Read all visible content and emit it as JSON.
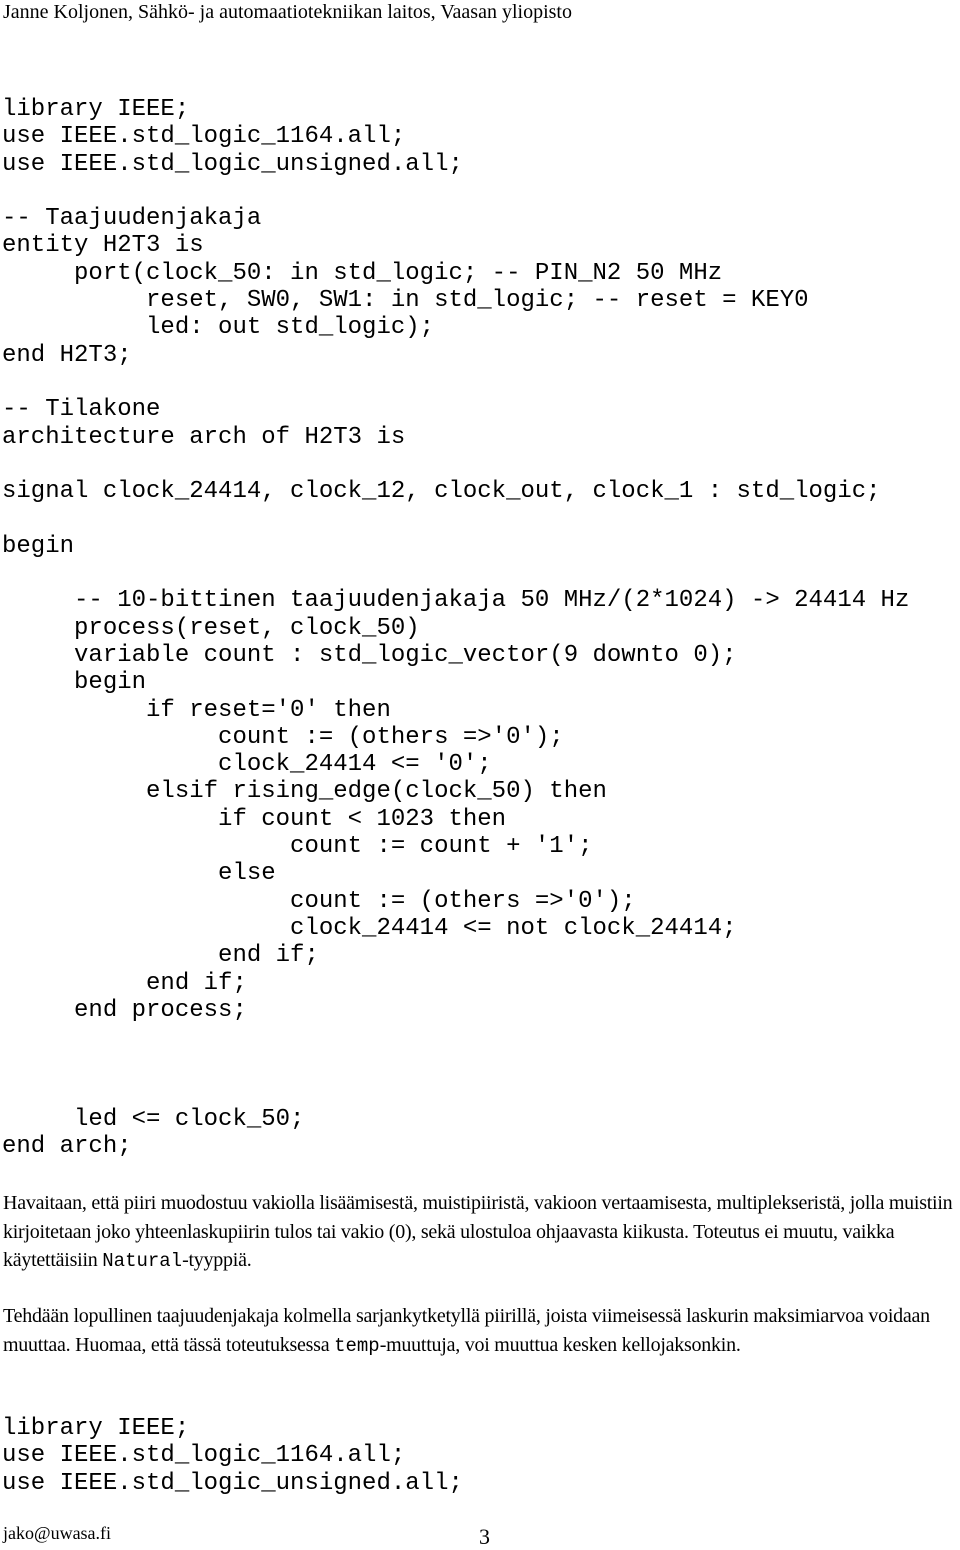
{
  "header": "Janne Koljonen, Sähkö- ja automaatiotekniikan laitos, Vaasan yliopisto",
  "code_block_1": [
    "library IEEE;",
    "use IEEE.std_logic_1164.all;",
    "use IEEE.std_logic_unsigned.all;",
    "",
    "-- Taajuudenjakaja",
    "entity H2T3 is",
    "     port(clock_50: in std_logic; -- PIN_N2 50 MHz",
    "          reset, SW0, SW1: in std_logic; -- reset = KEY0",
    "          led: out std_logic);",
    "end H2T3;",
    "",
    "-- Tilakone",
    "architecture arch of H2T3 is",
    "",
    "signal clock_24414, clock_12, clock_out, clock_1 : std_logic;",
    "",
    "begin",
    "",
    "     -- 10-bittinen taajuudenjakaja 50 MHz/(2*1024) -> 24414 Hz",
    "     process(reset, clock_50)",
    "     variable count : std_logic_vector(9 downto 0);",
    "     begin",
    "          if reset='0' then",
    "               count := (others =>'0');",
    "               clock_24414 <= '0';",
    "          elsif rising_edge(clock_50) then",
    "               if count < 1023 then",
    "                    count := count + '1';",
    "               else",
    "                    count := (others =>'0');",
    "                    clock_24414 <= not clock_24414;",
    "               end if;",
    "          end if;",
    "     end process;",
    "",
    "",
    "",
    "     led <= clock_50;",
    "end arch;"
  ],
  "paragraph_1": {
    "text_before": "Havaitaan, että piiri muodostuu vakiolla lisäämisestä, muistipiiristä, vakioon vertaamisesta, multiplekseristä, jolla muistiin kirjoitetaan joko yhteenlaskupiirin tulos tai vakio (0), sekä ulostuloa ohjaavasta kiikusta. Toteutus ei muutu, vaikka käytettäisiin ",
    "code": "Natural",
    "text_after": "-tyyppiä."
  },
  "paragraph_2": {
    "text_before": "Tehdään lopullinen taajuudenjakaja kolmella sarjankytketyllä piirillä, joista viimeisessä laskurin maksimiarvoa voidaan muuttaa. Huomaa, että tässä toteutuksessa ",
    "code": "temp",
    "text_after": "-muuttuja, voi muuttua kesken kellojaksonkin."
  },
  "code_block_2": [
    "library IEEE;",
    "use IEEE.std_logic_1164.all;",
    "use IEEE.std_logic_unsigned.all;"
  ],
  "footer": {
    "email": "jako@uwasa.fi",
    "page_number": "3"
  }
}
